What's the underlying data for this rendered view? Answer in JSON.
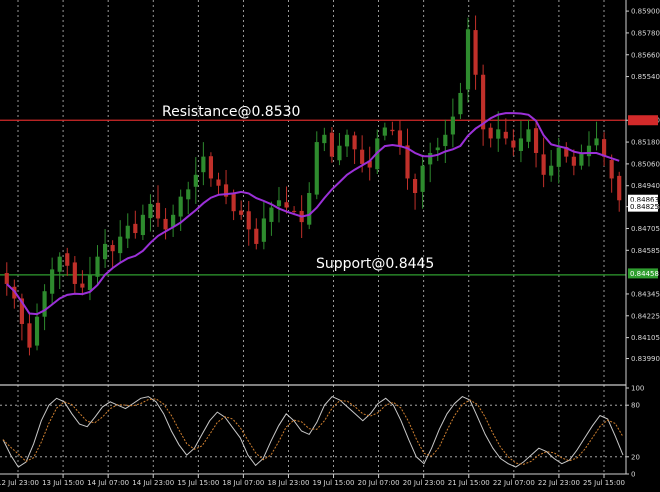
{
  "chart_data": [
    {
      "type": "candlestick",
      "ylim": [
        0.8385,
        0.8595
      ],
      "grid": true,
      "colors": {
        "bull": "#2e8b2e",
        "bear": "#c0302a",
        "ma": "#9b30d8",
        "resistance": "#d32a2a",
        "support": "#2f9e2f"
      },
      "y_ticks": [
        "0.85900",
        "0.85780",
        "0.85660",
        "0.85540",
        "0.85300",
        "0.85180",
        "0.85060",
        "0.84940",
        "0.84825",
        "0.84705",
        "0.84585",
        "0.84345",
        "0.84225",
        "0.84105",
        "0.83990"
      ],
      "x_ticks": [
        "12 Jul 23:00",
        "13 Jul 15:00",
        "14 Jul 07:00",
        "14 Jul 23:00",
        "15 Jul 15:00",
        "18 Jul 07:00",
        "18 Jul 23:00",
        "19 Jul 15:00",
        "20 Jul 07:00",
        "20 Jul 23:00",
        "21 Jul 15:00",
        "22 Jul 07:00",
        "22 Jul 23:00",
        "25 Jul 15:00"
      ],
      "annotations": [
        {
          "label": "Resistance@0.8530",
          "y": 0.853
        },
        {
          "label": "Support@0.8445",
          "y": 0.8445
        }
      ],
      "price_tags": [
        {
          "label": "0.84863",
          "y": 0.84863
        },
        {
          "label": "0.84825",
          "y": 0.84825
        },
        {
          "label": "0.84458",
          "y": 0.84458
        }
      ],
      "close": [
        0.844,
        0.8432,
        0.8418,
        0.8405,
        0.8422,
        0.8436,
        0.8448,
        0.8455,
        0.845,
        0.844,
        0.8438,
        0.8445,
        0.8455,
        0.8462,
        0.8458,
        0.8466,
        0.8472,
        0.8468,
        0.8478,
        0.8484,
        0.8476,
        0.847,
        0.8478,
        0.8488,
        0.8492,
        0.85,
        0.851,
        0.8498,
        0.8494,
        0.8488,
        0.848,
        0.8478,
        0.847,
        0.8462,
        0.8476,
        0.8482,
        0.8486,
        0.8482,
        0.848,
        0.8474,
        0.849,
        0.8518,
        0.8522,
        0.851,
        0.8516,
        0.8522,
        0.8514,
        0.8506,
        0.8504,
        0.852,
        0.8526,
        0.8524,
        0.8516,
        0.8498,
        0.849,
        0.8505,
        0.8512,
        0.8515,
        0.8522,
        0.8532,
        0.8545,
        0.858,
        0.8555,
        0.8525,
        0.852,
        0.8525,
        0.852,
        0.8515,
        0.852,
        0.8525,
        0.8512,
        0.85,
        0.8505,
        0.8515,
        0.851,
        0.8505,
        0.8512,
        0.8516,
        0.852,
        0.851,
        0.8498,
        0.8486
      ]
    },
    {
      "type": "line",
      "ylim": [
        0,
        100
      ],
      "y_ticks": [
        "100",
        "80",
        "20",
        "0"
      ],
      "levels": [
        80,
        20
      ],
      "colors": {
        "main": "#c8c8c8",
        "signal": "#d08030"
      },
      "values": [
        40,
        22,
        8,
        14,
        35,
        62,
        80,
        88,
        84,
        70,
        58,
        55,
        66,
        78,
        84,
        80,
        76,
        82,
        88,
        90,
        84,
        70,
        50,
        34,
        22,
        30,
        46,
        62,
        72,
        66,
        54,
        42,
        22,
        10,
        18,
        38,
        56,
        70,
        62,
        50,
        46,
        60,
        80,
        90,
        86,
        78,
        70,
        62,
        70,
        82,
        88,
        80,
        62,
        40,
        20,
        12,
        30,
        52,
        70,
        82,
        90,
        86,
        66,
        46,
        30,
        18,
        12,
        8,
        14,
        22,
        30,
        26,
        18,
        12,
        16,
        28,
        42,
        56,
        68,
        64,
        44,
        22
      ]
    }
  ]
}
